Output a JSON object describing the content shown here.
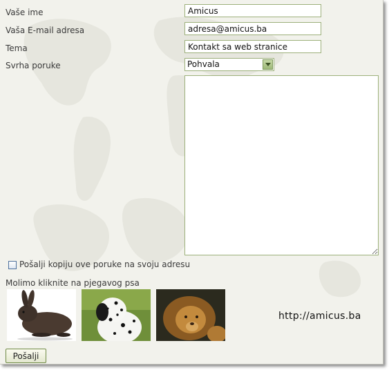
{
  "form": {
    "name_label": "Vaše ime",
    "name_value": "Amicus",
    "email_label": "Vaša E-mail adresa",
    "email_value": "adresa@amicus.ba",
    "subject_label": "Tema",
    "subject_value": "Kontakt sa web stranice",
    "purpose_label": "Svrha poruke",
    "purpose_selected": "Pohvala",
    "message_value": "",
    "copy_checkbox_label": "Pošalji kopiju ove poruke na svoju adresu",
    "copy_checked": false
  },
  "captcha": {
    "instruction": "Molimo kliknite na pjegavog psa",
    "images": [
      "rabbit",
      "dalmatian",
      "lion"
    ]
  },
  "site_url": "http://amicus.ba",
  "submit_label": "Pošalji",
  "colors": {
    "panel_bg": "#f2f2ec",
    "field_border": "#9cb07a",
    "button_border": "#6e8a44"
  }
}
